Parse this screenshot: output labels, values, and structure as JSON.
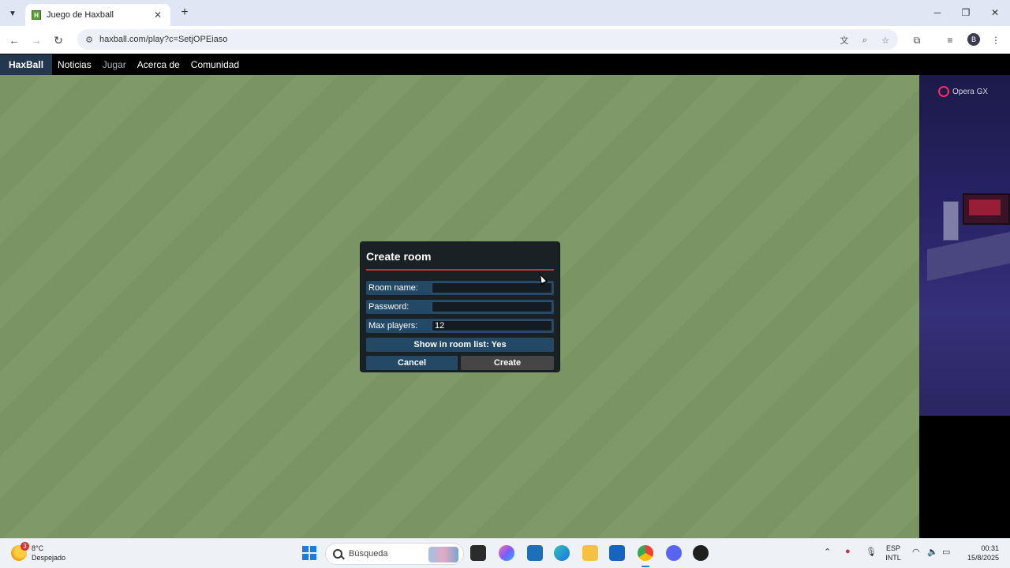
{
  "browser": {
    "tab_title": "Juego de Haxball",
    "url": "haxball.com/play?c=SetjOPEiaso",
    "profile_initial": "B"
  },
  "site_nav": {
    "brand": "HaxBall",
    "links": [
      "Noticias",
      "Jugar",
      "Acerca de",
      "Comunidad"
    ],
    "active": "Jugar"
  },
  "ad": {
    "brand": "Opera GX"
  },
  "dialog": {
    "title": "Create room",
    "room_name_label": "Room name:",
    "room_name_value": "",
    "password_label": "Password:",
    "password_value": "",
    "max_players_label": "Max players:",
    "max_players_value": "12",
    "show_in_list": "Show in room list: Yes",
    "cancel": "Cancel",
    "create": "Create"
  },
  "taskbar": {
    "weather_temp": "8°C",
    "weather_desc": "Despejado",
    "weather_badge": "3",
    "search_placeholder": "Búsqueda",
    "lang_1": "ESP",
    "lang_2": "INTL",
    "time": "00:31",
    "date": "15/8/2025"
  },
  "colors": {
    "dialog_bg": "#1a2125",
    "dialog_accent": "#c13535",
    "field_bg": "#244967",
    "field_green": "#7a9563"
  }
}
